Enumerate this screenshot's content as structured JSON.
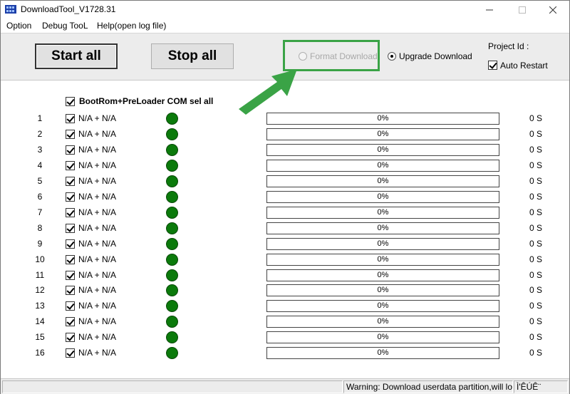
{
  "window": {
    "title": "DownloadTool_V1728.31"
  },
  "menu": {
    "items": [
      "Option",
      "Debug TooL",
      "Help(open log file)"
    ]
  },
  "toolbar": {
    "start_all": "Start all",
    "stop_all": "Stop all",
    "format_download": "Format Download",
    "format_download_selected": false,
    "format_download_enabled": false,
    "upgrade_download": "Upgrade Download",
    "upgrade_download_selected": true,
    "project_id_label": "Project Id :",
    "auto_restart_label": "Auto Restart",
    "auto_restart_checked": true,
    "highlight_color": "#3aa346"
  },
  "list": {
    "sel_all_label": "BootRom+PreLoader COM sel all",
    "sel_all_checked": true,
    "led_color": "#0b7a0b",
    "rows": [
      {
        "num": "1",
        "com": "N/A + N/A",
        "progress": "0%",
        "time": "0 S"
      },
      {
        "num": "2",
        "com": "N/A + N/A",
        "progress": "0%",
        "time": "0 S"
      },
      {
        "num": "3",
        "com": "N/A + N/A",
        "progress": "0%",
        "time": "0 S"
      },
      {
        "num": "4",
        "com": "N/A + N/A",
        "progress": "0%",
        "time": "0 S"
      },
      {
        "num": "5",
        "com": "N/A + N/A",
        "progress": "0%",
        "time": "0 S"
      },
      {
        "num": "6",
        "com": "N/A + N/A",
        "progress": "0%",
        "time": "0 S"
      },
      {
        "num": "7",
        "com": "N/A + N/A",
        "progress": "0%",
        "time": "0 S"
      },
      {
        "num": "8",
        "com": "N/A + N/A",
        "progress": "0%",
        "time": "0 S"
      },
      {
        "num": "9",
        "com": "N/A + N/A",
        "progress": "0%",
        "time": "0 S"
      },
      {
        "num": "10",
        "com": "N/A + N/A",
        "progress": "0%",
        "time": "0 S"
      },
      {
        "num": "11",
        "com": "N/A + N/A",
        "progress": "0%",
        "time": "0 S"
      },
      {
        "num": "12",
        "com": "N/A + N/A",
        "progress": "0%",
        "time": "0 S"
      },
      {
        "num": "13",
        "com": "N/A + N/A",
        "progress": "0%",
        "time": "0 S"
      },
      {
        "num": "14",
        "com": "N/A + N/A",
        "progress": "0%",
        "time": "0 S"
      },
      {
        "num": "15",
        "com": "N/A + N/A",
        "progress": "0%",
        "time": "0 S"
      },
      {
        "num": "16",
        "com": "N/A + N/A",
        "progress": "0%",
        "time": "0 S"
      }
    ]
  },
  "statusbar": {
    "warning": "Warning: Download userdata partition,will lo",
    "extra": "Ì'ÊÚÊ¨"
  }
}
